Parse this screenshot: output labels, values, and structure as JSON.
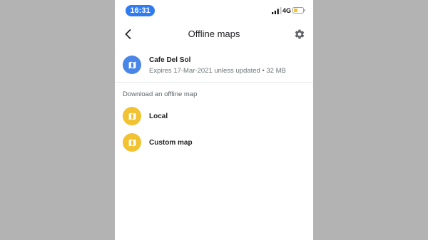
{
  "status_bar": {
    "time": "16:31",
    "network": "4G",
    "time_pill_color": "#2f7bf0",
    "battery_color": "#f1c232"
  },
  "header": {
    "title": "Offline maps",
    "back_icon": "back-chevron-icon",
    "settings_icon": "gear-icon"
  },
  "saved_maps": [
    {
      "name": "Cafe Del Sol",
      "meta": "Expires 17-Mar-2021 unless updated • 32 MB",
      "icon": "map-icon",
      "icon_color": "#4a86e8"
    }
  ],
  "download_section": {
    "label": "Download an offline map",
    "items": [
      {
        "label": "Local",
        "icon": "map-icon",
        "icon_color": "#f1c232"
      },
      {
        "label": "Custom map",
        "icon": "map-icon",
        "icon_color": "#f1c232"
      }
    ]
  }
}
